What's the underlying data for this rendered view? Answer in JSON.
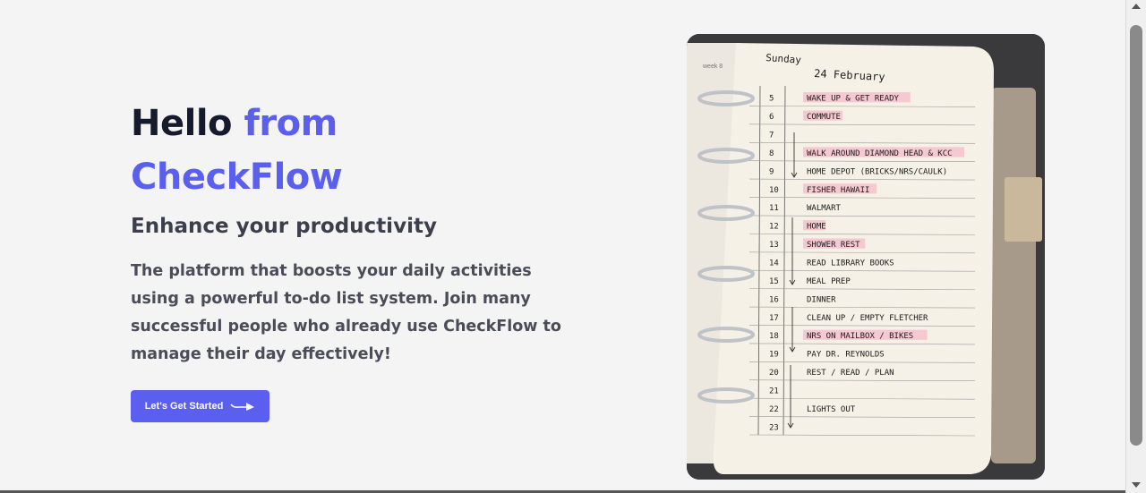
{
  "hero": {
    "title_part1": "Hello",
    "title_part2": "from",
    "title_part3": "CheckFlow",
    "subtitle": "Enhance your productivity",
    "description": "The platform that boosts your daily activities using a powerful to-do list system. Join many successful people who already use CheckFlow to manage their day effectively!",
    "cta_label": "Let's Get Started",
    "cta_icon": "arrow-right-icon"
  },
  "image": {
    "description_alt": "planner",
    "planner": {
      "day": "Sunday",
      "date": "24 February",
      "side_tab": "week 8",
      "entries": [
        {
          "hour": "5",
          "task": "Wake up & get ready",
          "highlight": true
        },
        {
          "hour": "6",
          "task": "Commute",
          "highlight": true
        },
        {
          "hour": "7",
          "task": "",
          "highlight": false
        },
        {
          "hour": "8",
          "task": "Walk around Diamond Head & KCC",
          "highlight": true
        },
        {
          "hour": "9",
          "task": "Home Depot (bricks/NRS/caulk)",
          "highlight": false
        },
        {
          "hour": "10",
          "task": "Fisher Hawaii",
          "highlight": true
        },
        {
          "hour": "11",
          "task": "Walmart",
          "highlight": false
        },
        {
          "hour": "12",
          "task": "Home",
          "highlight": true
        },
        {
          "hour": "13",
          "task": "Shower Rest",
          "highlight": true
        },
        {
          "hour": "14",
          "task": "Read library books",
          "highlight": false
        },
        {
          "hour": "15",
          "task": "Meal prep",
          "highlight": false
        },
        {
          "hour": "16",
          "task": "Dinner",
          "highlight": false
        },
        {
          "hour": "17",
          "task": "Clean up / Empty Fletcher",
          "highlight": false
        },
        {
          "hour": "18",
          "task": "NRS on mailbox / bikes",
          "highlight": true
        },
        {
          "hour": "19",
          "task": "Pay Dr. Reynolds",
          "highlight": false
        },
        {
          "hour": "20",
          "task": "Rest / Read / Plan",
          "highlight": false
        },
        {
          "hour": "21",
          "task": "",
          "highlight": false
        },
        {
          "hour": "22",
          "task": "Lights out",
          "highlight": false
        },
        {
          "hour": "23",
          "task": "",
          "highlight": false
        }
      ]
    }
  },
  "colors": {
    "accent": "#5b5ff0",
    "title_dark": "#151a2c",
    "highlight": "#f6a6bf"
  }
}
